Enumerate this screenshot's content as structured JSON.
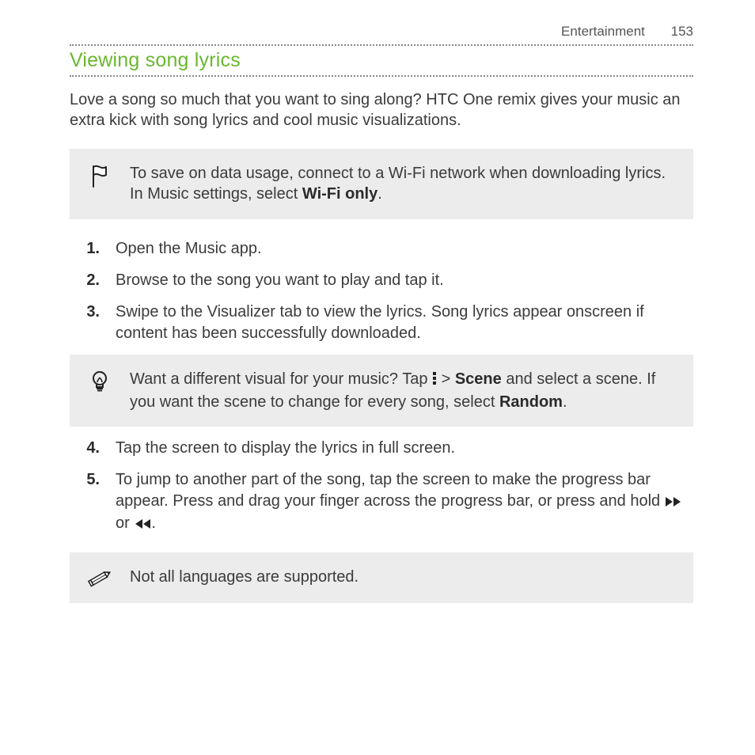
{
  "header": {
    "chapter": "Entertainment",
    "page": "153"
  },
  "title": "Viewing song lyrics",
  "intro": "Love a song so much that you want to sing along? HTC One remix gives your music an extra kick with song lyrics and cool music visualizations.",
  "callout_wifi": {
    "pre": "To save on data usage, connect to a Wi-Fi network when downloading lyrics. In Music settings, select ",
    "bold": "Wi-Fi only",
    "post": "."
  },
  "steps": {
    "s1": {
      "num": "1.",
      "text": "Open the Music app."
    },
    "s2": {
      "num": "2.",
      "text": "Browse to the song you want to play and tap it."
    },
    "s3": {
      "num": "3.",
      "text": "Swipe to the Visualizer tab to view the lyrics. Song lyrics appear onscreen if content has been successfully downloaded."
    },
    "s4": {
      "num": "4.",
      "text": "Tap the screen to display the lyrics in full screen."
    },
    "s5": {
      "num": "5.",
      "pre": "To jump to another part of the song, tap the screen to make the progress bar appear. Press and drag your finger across the progress bar, or press and hold ",
      "mid": " or ",
      "post": "."
    }
  },
  "callout_scene": {
    "pre": "Want a different visual for your music? Tap ",
    "gt": " > ",
    "bold1": "Scene",
    "mid": " and select a scene. If you want the scene to change for every song, select ",
    "bold2": "Random",
    "post": "."
  },
  "callout_note": "Not all languages are supported.",
  "icons": {
    "flag": "flag-icon",
    "bulb": "lightbulb-icon",
    "pencil": "pencil-icon",
    "menu_dots": "menu-dots-icon",
    "ff": "fast-forward-icon",
    "rw": "rewind-icon"
  }
}
